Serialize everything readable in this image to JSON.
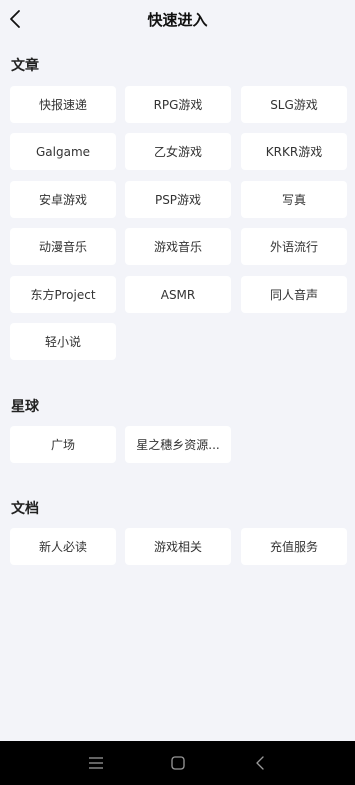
{
  "header": {
    "title": "快速进入",
    "back_icon": "chevron-left-icon"
  },
  "sections": [
    {
      "title": "文章",
      "items": [
        "快报速递",
        "RPG游戏",
        "SLG游戏",
        "Galgame",
        "乙女游戏",
        "KRKR游戏",
        "安卓游戏",
        "PSP游戏",
        "写真",
        "动漫音乐",
        "游戏音乐",
        "外语流行",
        "东方Project",
        "ASMR",
        "同人音声",
        "轻小说"
      ]
    },
    {
      "title": "星球",
      "items": [
        "广场",
        "星之穗乡资源..."
      ]
    },
    {
      "title": "文档",
      "items": [
        "新人必读",
        "游戏相关",
        "充值服务"
      ]
    }
  ],
  "nav_bar": {
    "icons": [
      "menu-icon",
      "home-icon",
      "back-icon"
    ]
  }
}
